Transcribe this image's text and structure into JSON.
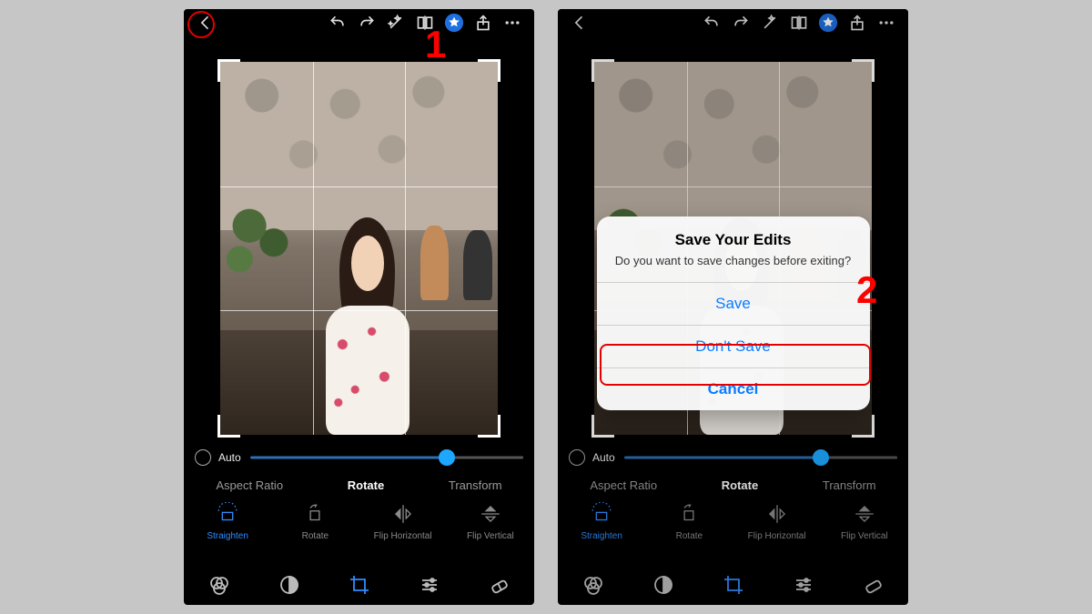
{
  "annotations": {
    "step1": "1",
    "step2": "2"
  },
  "topbar": {
    "icons": [
      "back",
      "undo",
      "redo",
      "magic",
      "compare",
      "star",
      "share",
      "more"
    ]
  },
  "slider": {
    "auto_label": "Auto",
    "value_pct": 72
  },
  "tabs": {
    "items": [
      "Aspect Ratio",
      "Rotate",
      "Transform"
    ],
    "active_index": 1
  },
  "tools": {
    "items": [
      {
        "label": "Straighten",
        "icon": "straighten",
        "active": true
      },
      {
        "label": "Rotate",
        "icon": "rotate",
        "active": false
      },
      {
        "label": "Flip Horizontal",
        "icon": "flip-h",
        "active": false
      },
      {
        "label": "Flip Vertical",
        "icon": "flip-v",
        "active": false
      }
    ]
  },
  "bottombar": {
    "icons": [
      "filters",
      "contrast",
      "crop",
      "adjust",
      "heal"
    ],
    "active_index": 2
  },
  "dialog": {
    "title": "Save Your Edits",
    "message": "Do you want to save changes before exiting?",
    "buttons": [
      "Save",
      "Don't Save",
      "Cancel"
    ]
  }
}
